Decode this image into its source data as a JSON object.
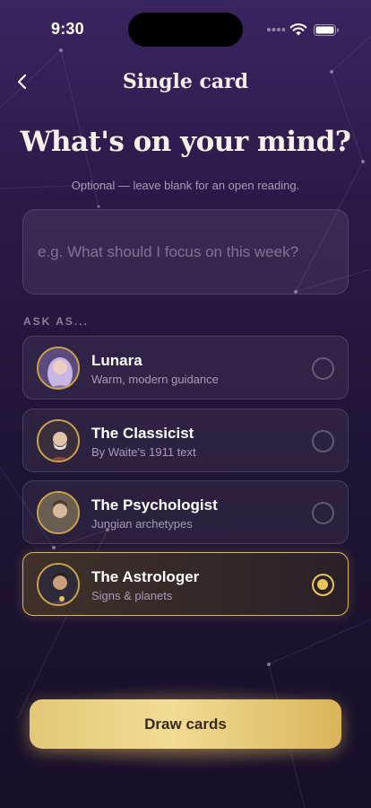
{
  "status_bar": {
    "time": "9:30",
    "icons": [
      "signal-icon",
      "wifi-icon",
      "battery-icon"
    ]
  },
  "nav": {
    "back_icon": "chevron-left-icon",
    "title": "Single card"
  },
  "headline": "What's on your mind?",
  "subtext": "Optional — leave blank for an open reading.",
  "question": {
    "value": "",
    "placeholder": "e.g. What should I focus on this week?"
  },
  "section_label": "ASK AS...",
  "personas": [
    {
      "name": "Lunara",
      "description": "Warm, modern guidance",
      "selected": false,
      "avatar_color": "#8e76b8"
    },
    {
      "name": "The Classicist",
      "description": "By Waite's 1911 text",
      "selected": false,
      "avatar_color": "#8a4a3a"
    },
    {
      "name": "The Psychologist",
      "description": "Jungian archetypes",
      "selected": false,
      "avatar_color": "#6a5a6e"
    },
    {
      "name": "The Astrologer",
      "description": "Signs & planets",
      "selected": true,
      "avatar_color": "#4a3a5e"
    }
  ],
  "draw_button": {
    "label": "Draw cards"
  },
  "colors": {
    "accent_gold": "#e6c55a",
    "background_top": "#3a2560",
    "background_bottom": "#170f28"
  }
}
